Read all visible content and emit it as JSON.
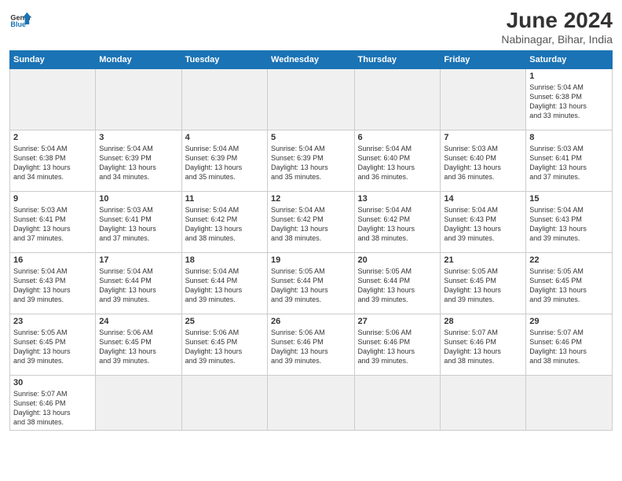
{
  "header": {
    "logo_general": "General",
    "logo_blue": "Blue",
    "month_title": "June 2024",
    "subtitle": "Nabinagar, Bihar, India"
  },
  "weekdays": [
    "Sunday",
    "Monday",
    "Tuesday",
    "Wednesday",
    "Thursday",
    "Friday",
    "Saturday"
  ],
  "weeks": [
    [
      {
        "day": "",
        "info": ""
      },
      {
        "day": "",
        "info": ""
      },
      {
        "day": "",
        "info": ""
      },
      {
        "day": "",
        "info": ""
      },
      {
        "day": "",
        "info": ""
      },
      {
        "day": "",
        "info": ""
      },
      {
        "day": "1",
        "info": "Sunrise: 5:04 AM\nSunset: 6:38 PM\nDaylight: 13 hours\nand 33 minutes."
      }
    ],
    [
      {
        "day": "2",
        "info": "Sunrise: 5:04 AM\nSunset: 6:38 PM\nDaylight: 13 hours\nand 34 minutes."
      },
      {
        "day": "3",
        "info": "Sunrise: 5:04 AM\nSunset: 6:39 PM\nDaylight: 13 hours\nand 34 minutes."
      },
      {
        "day": "4",
        "info": "Sunrise: 5:04 AM\nSunset: 6:39 PM\nDaylight: 13 hours\nand 35 minutes."
      },
      {
        "day": "5",
        "info": "Sunrise: 5:04 AM\nSunset: 6:39 PM\nDaylight: 13 hours\nand 35 minutes."
      },
      {
        "day": "6",
        "info": "Sunrise: 5:04 AM\nSunset: 6:40 PM\nDaylight: 13 hours\nand 36 minutes."
      },
      {
        "day": "7",
        "info": "Sunrise: 5:03 AM\nSunset: 6:40 PM\nDaylight: 13 hours\nand 36 minutes."
      },
      {
        "day": "8",
        "info": "Sunrise: 5:03 AM\nSunset: 6:41 PM\nDaylight: 13 hours\nand 37 minutes."
      }
    ],
    [
      {
        "day": "9",
        "info": "Sunrise: 5:03 AM\nSunset: 6:41 PM\nDaylight: 13 hours\nand 37 minutes."
      },
      {
        "day": "10",
        "info": "Sunrise: 5:03 AM\nSunset: 6:41 PM\nDaylight: 13 hours\nand 37 minutes."
      },
      {
        "day": "11",
        "info": "Sunrise: 5:04 AM\nSunset: 6:42 PM\nDaylight: 13 hours\nand 38 minutes."
      },
      {
        "day": "12",
        "info": "Sunrise: 5:04 AM\nSunset: 6:42 PM\nDaylight: 13 hours\nand 38 minutes."
      },
      {
        "day": "13",
        "info": "Sunrise: 5:04 AM\nSunset: 6:42 PM\nDaylight: 13 hours\nand 38 minutes."
      },
      {
        "day": "14",
        "info": "Sunrise: 5:04 AM\nSunset: 6:43 PM\nDaylight: 13 hours\nand 39 minutes."
      },
      {
        "day": "15",
        "info": "Sunrise: 5:04 AM\nSunset: 6:43 PM\nDaylight: 13 hours\nand 39 minutes."
      }
    ],
    [
      {
        "day": "16",
        "info": "Sunrise: 5:04 AM\nSunset: 6:43 PM\nDaylight: 13 hours\nand 39 minutes."
      },
      {
        "day": "17",
        "info": "Sunrise: 5:04 AM\nSunset: 6:44 PM\nDaylight: 13 hours\nand 39 minutes."
      },
      {
        "day": "18",
        "info": "Sunrise: 5:04 AM\nSunset: 6:44 PM\nDaylight: 13 hours\nand 39 minutes."
      },
      {
        "day": "19",
        "info": "Sunrise: 5:05 AM\nSunset: 6:44 PM\nDaylight: 13 hours\nand 39 minutes."
      },
      {
        "day": "20",
        "info": "Sunrise: 5:05 AM\nSunset: 6:44 PM\nDaylight: 13 hours\nand 39 minutes."
      },
      {
        "day": "21",
        "info": "Sunrise: 5:05 AM\nSunset: 6:45 PM\nDaylight: 13 hours\nand 39 minutes."
      },
      {
        "day": "22",
        "info": "Sunrise: 5:05 AM\nSunset: 6:45 PM\nDaylight: 13 hours\nand 39 minutes."
      }
    ],
    [
      {
        "day": "23",
        "info": "Sunrise: 5:05 AM\nSunset: 6:45 PM\nDaylight: 13 hours\nand 39 minutes."
      },
      {
        "day": "24",
        "info": "Sunrise: 5:06 AM\nSunset: 6:45 PM\nDaylight: 13 hours\nand 39 minutes."
      },
      {
        "day": "25",
        "info": "Sunrise: 5:06 AM\nSunset: 6:45 PM\nDaylight: 13 hours\nand 39 minutes."
      },
      {
        "day": "26",
        "info": "Sunrise: 5:06 AM\nSunset: 6:46 PM\nDaylight: 13 hours\nand 39 minutes."
      },
      {
        "day": "27",
        "info": "Sunrise: 5:06 AM\nSunset: 6:46 PM\nDaylight: 13 hours\nand 39 minutes."
      },
      {
        "day": "28",
        "info": "Sunrise: 5:07 AM\nSunset: 6:46 PM\nDaylight: 13 hours\nand 38 minutes."
      },
      {
        "day": "29",
        "info": "Sunrise: 5:07 AM\nSunset: 6:46 PM\nDaylight: 13 hours\nand 38 minutes."
      }
    ],
    [
      {
        "day": "30",
        "info": "Sunrise: 5:07 AM\nSunset: 6:46 PM\nDaylight: 13 hours\nand 38 minutes."
      },
      {
        "day": "",
        "info": ""
      },
      {
        "day": "",
        "info": ""
      },
      {
        "day": "",
        "info": ""
      },
      {
        "day": "",
        "info": ""
      },
      {
        "day": "",
        "info": ""
      },
      {
        "day": "",
        "info": ""
      }
    ]
  ]
}
